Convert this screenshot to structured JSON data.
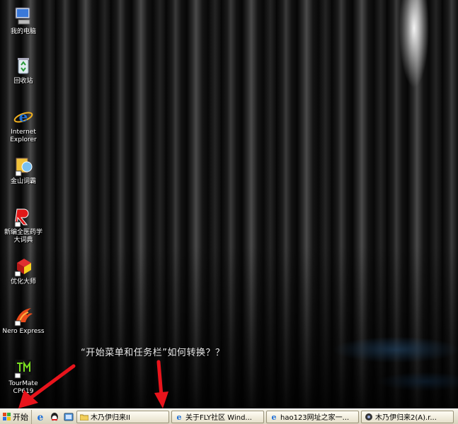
{
  "desktop": {
    "icons": [
      {
        "label": "我的电脑"
      },
      {
        "label": "回收站"
      },
      {
        "label": "Internet\nExplorer"
      },
      {
        "label": "金山词霸"
      },
      {
        "label": "新编全医药学\n大词典"
      },
      {
        "label": "优化大师"
      },
      {
        "label": "Nero Express"
      },
      {
        "label": "TourMate\nCP619"
      }
    ],
    "caption": "“开始菜单和任务栏”如何转换？？"
  },
  "taskbar": {
    "start_label": "开始",
    "tasks": [
      {
        "label": "木乃伊归来II"
      },
      {
        "label": "关于FLY社区 Wind..."
      },
      {
        "label": "hao123网址之家一..."
      },
      {
        "label": "木乃伊归来2(A).r..."
      }
    ]
  },
  "colors": {
    "arrow": "#e8141c",
    "taskbar": "#ece9d8"
  }
}
